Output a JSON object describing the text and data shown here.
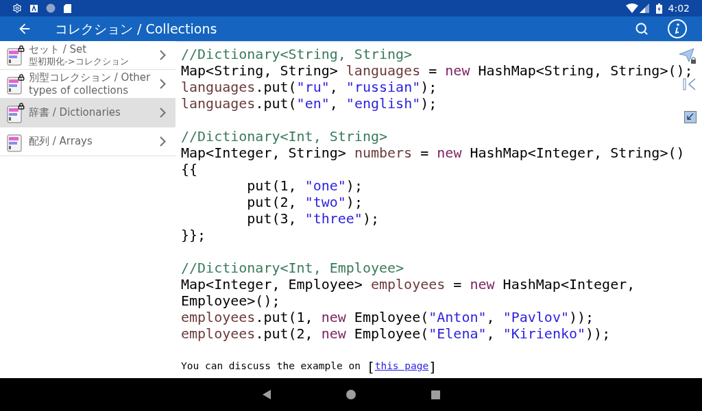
{
  "status_bar": {
    "time": "4:02"
  },
  "app_bar": {
    "title": "コレクション / Collections"
  },
  "sidebar": {
    "items": [
      {
        "title": "セット / Set",
        "subtitle": "型初期化->コレクション",
        "locked": true,
        "selected": false
      },
      {
        "title": "別型コレクション / Other types of collections",
        "locked": true,
        "selected": false
      },
      {
        "title": "辞書 / Dictionaries",
        "locked": true,
        "selected": true
      },
      {
        "title": "配列 / Arrays",
        "locked": false,
        "selected": false
      }
    ]
  },
  "code": {
    "blocks": [
      {
        "lines": [
          [
            {
              "kind": "comment",
              "text": "//Dictionary<String, String>"
            }
          ],
          [
            {
              "kind": "plain",
              "text": "Map<String, String> "
            },
            {
              "kind": "var",
              "text": "languages"
            },
            {
              "kind": "plain",
              "text": " = "
            },
            {
              "kind": "keyword",
              "text": "new"
            },
            {
              "kind": "plain",
              "text": " HashMap<String, String>();"
            }
          ],
          [
            {
              "kind": "var",
              "text": "languages"
            },
            {
              "kind": "plain",
              "text": ".put("
            },
            {
              "kind": "string",
              "text": "\"ru\""
            },
            {
              "kind": "plain",
              "text": ", "
            },
            {
              "kind": "string",
              "text": "\"russian\""
            },
            {
              "kind": "plain",
              "text": ");"
            }
          ],
          [
            {
              "kind": "var",
              "text": "languages"
            },
            {
              "kind": "plain",
              "text": ".put("
            },
            {
              "kind": "string",
              "text": "\"en\""
            },
            {
              "kind": "plain",
              "text": ", "
            },
            {
              "kind": "string",
              "text": "\"english\""
            },
            {
              "kind": "plain",
              "text": ");"
            }
          ]
        ]
      },
      {
        "lines": [
          [
            {
              "kind": "comment",
              "text": "//Dictionary<Int, String>"
            }
          ],
          [
            {
              "kind": "plain",
              "text": "Map<Integer, String> "
            },
            {
              "kind": "var",
              "text": "numbers"
            },
            {
              "kind": "plain",
              "text": " = "
            },
            {
              "kind": "keyword",
              "text": "new"
            },
            {
              "kind": "plain",
              "text": " HashMap<Integer, String>()"
            }
          ],
          [
            {
              "kind": "plain",
              "text": "{{"
            }
          ],
          [
            {
              "kind": "plain",
              "text": "        put(1, "
            },
            {
              "kind": "string",
              "text": "\"one\""
            },
            {
              "kind": "plain",
              "text": ");"
            }
          ],
          [
            {
              "kind": "plain",
              "text": "        put(2, "
            },
            {
              "kind": "string",
              "text": "\"two\""
            },
            {
              "kind": "plain",
              "text": ");"
            }
          ],
          [
            {
              "kind": "plain",
              "text": "        put(3, "
            },
            {
              "kind": "string",
              "text": "\"three\""
            },
            {
              "kind": "plain",
              "text": ");"
            }
          ],
          [
            {
              "kind": "plain",
              "text": "}};"
            }
          ]
        ]
      },
      {
        "lines": [
          [
            {
              "kind": "comment",
              "text": "//Dictionary<Int, Employee>"
            }
          ],
          [
            {
              "kind": "plain",
              "text": "Map<Integer, Employee> "
            },
            {
              "kind": "var",
              "text": "employees"
            },
            {
              "kind": "plain",
              "text": " = "
            },
            {
              "kind": "keyword",
              "text": "new"
            },
            {
              "kind": "plain",
              "text": " HashMap<Integer,"
            }
          ],
          [
            {
              "kind": "plain",
              "text": "Employee>();"
            }
          ],
          [
            {
              "kind": "var",
              "text": "employees"
            },
            {
              "kind": "plain",
              "text": ".put(1, "
            },
            {
              "kind": "keyword",
              "text": "new"
            },
            {
              "kind": "plain",
              "text": " Employee("
            },
            {
              "kind": "string",
              "text": "\"Anton\""
            },
            {
              "kind": "plain",
              "text": ", "
            },
            {
              "kind": "string",
              "text": "\"Pavlov\""
            },
            {
              "kind": "plain",
              "text": "));"
            }
          ],
          [
            {
              "kind": "var",
              "text": "employees"
            },
            {
              "kind": "plain",
              "text": ".put(2, "
            },
            {
              "kind": "keyword",
              "text": "new"
            },
            {
              "kind": "plain",
              "text": " Employee("
            },
            {
              "kind": "string",
              "text": "\"Elena\""
            },
            {
              "kind": "plain",
              "text": ", "
            },
            {
              "kind": "string",
              "text": "\"Kirienko\""
            },
            {
              "kind": "plain",
              "text": "));"
            }
          ]
        ]
      }
    ]
  },
  "footer": {
    "text": "You can discuss the example on",
    "bracket_open": "[",
    "link": "this page",
    "bracket_close": "]"
  }
}
